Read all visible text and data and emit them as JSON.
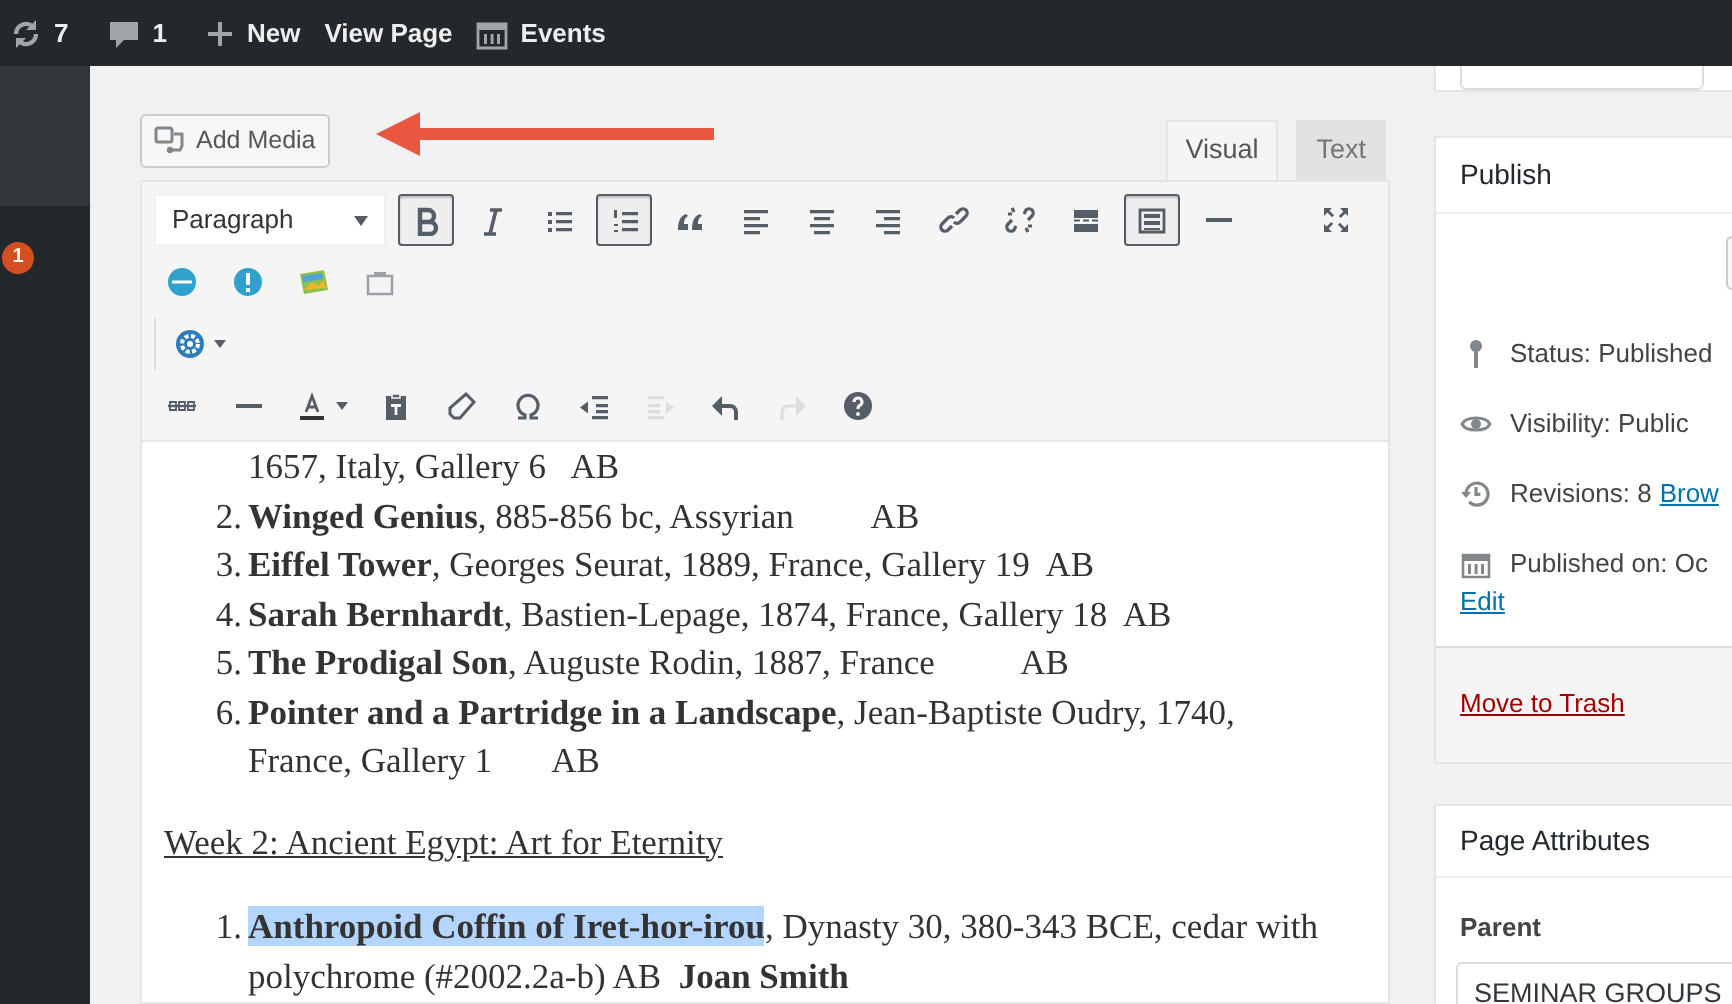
{
  "admin_bar": {
    "items": [
      {
        "kind": "updates",
        "label": "7"
      },
      {
        "kind": "comments",
        "label": "1"
      },
      {
        "kind": "new",
        "label": "New"
      },
      {
        "kind": "link",
        "label": "View Page"
      },
      {
        "kind": "events",
        "label": "Events"
      }
    ]
  },
  "sidebar": {
    "badge": "1"
  },
  "editor": {
    "add_media": "Add Media",
    "tabs": [
      {
        "label": "Visual",
        "selected": true
      },
      {
        "label": "Text",
        "selected": false
      }
    ],
    "toolbar": {
      "format": "Paragraph",
      "rows": [
        [
          {
            "kind": "bold",
            "active": true,
            "disabled": false
          },
          {
            "kind": "italic",
            "active": false,
            "disabled": false
          },
          {
            "kind": "bullet-list",
            "active": false,
            "disabled": false
          },
          {
            "kind": "numbered-list",
            "active": true,
            "disabled": false
          },
          {
            "kind": "quote",
            "active": false,
            "disabled": false
          },
          {
            "kind": "align-left",
            "active": false,
            "disabled": false
          },
          {
            "kind": "align-center",
            "active": false,
            "disabled": false
          },
          {
            "kind": "align-right",
            "active": false,
            "disabled": false
          },
          {
            "kind": "link",
            "active": false,
            "disabled": false
          },
          {
            "kind": "unlink",
            "active": false,
            "disabled": false
          },
          {
            "kind": "read-more",
            "active": false,
            "disabled": false
          },
          {
            "kind": "toolbar-toggle",
            "active": true,
            "disabled": false
          },
          {
            "kind": "horizontal-line",
            "active": false,
            "disabled": false
          },
          {
            "kind": "fullscreen",
            "active": false,
            "disabled": false
          }
        ],
        [
          {
            "kind": "plugin-badge",
            "active": false,
            "disabled": false
          },
          {
            "kind": "alert",
            "active": false,
            "disabled": false
          },
          {
            "kind": "image",
            "active": false,
            "disabled": false
          },
          {
            "kind": "slides",
            "active": false,
            "disabled": false
          }
        ],
        [
          {
            "kind": "gear-menu",
            "active": false,
            "disabled": false
          }
        ],
        [
          {
            "kind": "strikethrough",
            "active": false,
            "disabled": false
          },
          {
            "kind": "horizontal-line",
            "active": false,
            "disabled": false
          },
          {
            "kind": "text-color",
            "active": false,
            "disabled": false
          },
          {
            "kind": "paste-text",
            "active": false,
            "disabled": false
          },
          {
            "kind": "eraser",
            "active": false,
            "disabled": false
          },
          {
            "kind": "omega",
            "active": false,
            "disabled": false
          },
          {
            "kind": "outdent",
            "active": false,
            "disabled": false
          },
          {
            "kind": "indent",
            "active": false,
            "disabled": true
          },
          {
            "kind": "undo",
            "active": false,
            "disabled": false
          },
          {
            "kind": "redo",
            "active": false,
            "disabled": true
          },
          {
            "kind": "help",
            "active": false,
            "disabled": false
          }
        ]
      ]
    },
    "content": {
      "list_1": [
        {
          "rest": "1657, Italy, Gallery 6   AB"
        },
        {
          "number": "2.",
          "title": "Winged Genius",
          "rest": ", 885-856 bc, Assyrian         AB"
        },
        {
          "number": "3.",
          "title": "Eiffel Tower",
          "rest": ", Georges Seurat, 1889, France, Gallery 19  AB"
        },
        {
          "number": "4.",
          "title": "Sarah Bernhardt",
          "rest": ", Bastien-Lepage, 1874, France, Gallery 18  AB"
        },
        {
          "number": "5.",
          "title": "The Prodigal Son",
          "rest": ", Auguste Rodin, 1887, France          AB"
        },
        {
          "number": "6.",
          "title": "Pointer and a Partridge in a Landscape",
          "rest": ", Jean-Baptiste Oudry, 1740, France, Gallery 1       AB"
        }
      ],
      "heading": "Week 2: Ancient Egypt: Art for Eternity",
      "list_2": [
        {
          "number": "1.",
          "title": "Anthropoid Coffin of Iret-hor-irou",
          "title_selected": true,
          "rest": ", Dynasty 30, 380-343 BCE, cedar with polychrome (#2002.2a-b) AB  **Joan Smith**"
        }
      ]
    }
  },
  "publish": {
    "title": "Publish",
    "rows": [
      {
        "kind": "status",
        "text": "Status: Published"
      },
      {
        "kind": "visibility",
        "text": "Visibility: Public"
      },
      {
        "kind": "revisions",
        "text": "Revisions: 8",
        "link": "Brow"
      },
      {
        "kind": "date",
        "text": "Published on: Oc"
      }
    ],
    "edit_link": "Edit",
    "trash": "Move to Trash"
  },
  "page_attributes": {
    "title": "Page Attributes",
    "parent_label": "Parent",
    "parent_value": "SEMINAR GROUPS"
  }
}
